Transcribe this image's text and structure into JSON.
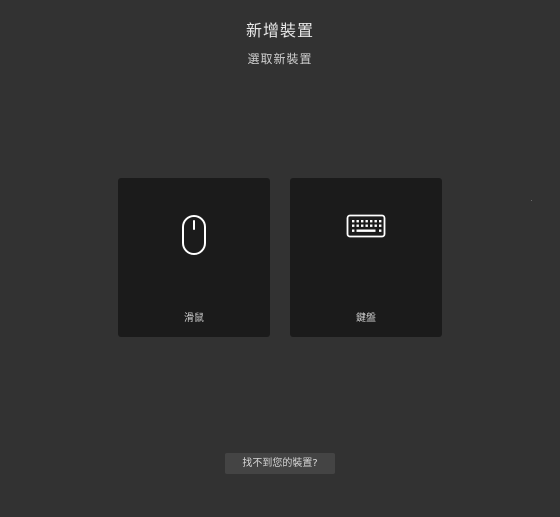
{
  "header": {
    "title": "新增裝置",
    "subtitle": "選取新裝置"
  },
  "devices": [
    {
      "label": "滑鼠",
      "icon": "mouse-icon"
    },
    {
      "label": "鍵盤",
      "icon": "keyboard-icon"
    }
  ],
  "footer": {
    "help_label": "找不到您的裝置?"
  },
  "colors": {
    "background": "#323232",
    "card": "#1b1b1b",
    "button": "#444444",
    "icon": "#ffffff"
  }
}
